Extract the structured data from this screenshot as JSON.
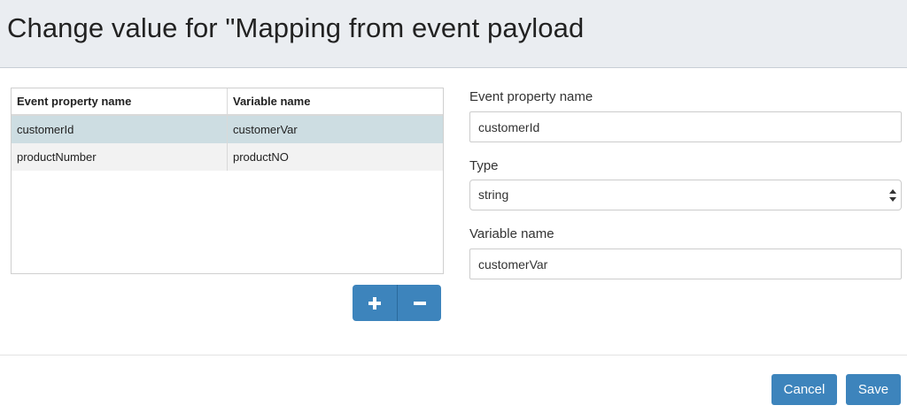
{
  "dialog": {
    "title": "Change value for \"Mapping from event payload"
  },
  "table": {
    "headers": [
      "Event property name",
      "Variable name"
    ],
    "rows": [
      {
        "event_property": "customerId",
        "variable": "customerVar",
        "selected": true
      },
      {
        "event_property": "productNumber",
        "variable": "productNO",
        "selected": false
      }
    ]
  },
  "buttons": {
    "add_icon": "plus-icon",
    "remove_icon": "minus-icon",
    "cancel_label": "Cancel",
    "save_label": "Save"
  },
  "form": {
    "event_property_label": "Event property name",
    "event_property_value": "customerId",
    "type_label": "Type",
    "type_value": "string",
    "variable_label": "Variable name",
    "variable_value": "customerVar"
  },
  "colors": {
    "header_bg": "#eaedf1",
    "selected_row": "#cddde2",
    "primary_button": "#3d84bc"
  }
}
